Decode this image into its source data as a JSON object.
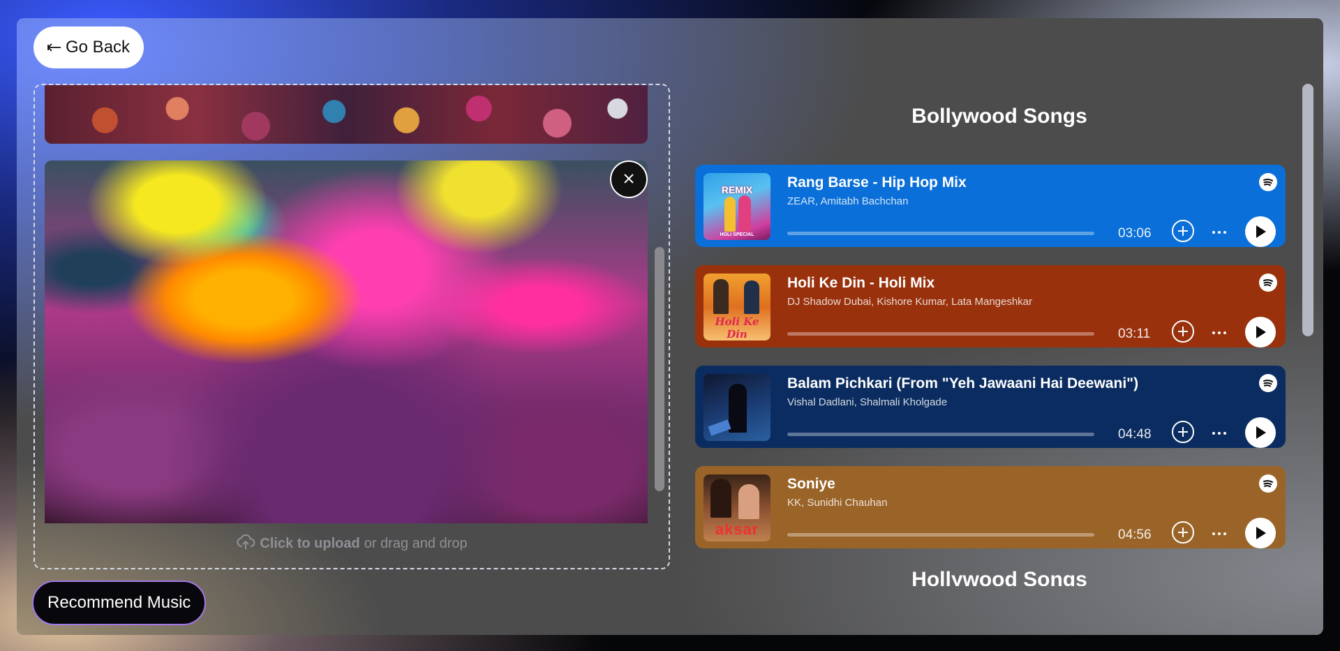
{
  "nav": {
    "back_label": "Go Back"
  },
  "upload": {
    "click_text": "Click to upload",
    "drag_text": "or drag and drop"
  },
  "actions": {
    "recommend_label": "Recommend Music"
  },
  "sections": [
    {
      "title": "Bollywood Songs"
    },
    {
      "title": "Hollywood Songs"
    }
  ],
  "songs": [
    {
      "title": "Rang Barse - Hip Hop Mix",
      "artists": "ZEAR, Amitabh Bachchan",
      "duration": "03:06",
      "color": "#0a6fd8",
      "cover_icon": "album-cover-bollywood-remix"
    },
    {
      "title": "Holi Ke Din - Holi Mix",
      "artists": "DJ Shadow Dubai, Kishore Kumar, Lata Mangeshkar",
      "duration": "03:11",
      "color": "#98310c",
      "cover_icon": "album-cover-holi-ke-din"
    },
    {
      "title": "Balam Pichkari (From \"Yeh Jawaani Hai Deewani\")",
      "artists": "Vishal Dadlani, Shalmali Kholgade",
      "duration": "04:48",
      "color": "#0a2c60",
      "cover_icon": "album-cover-yjhd"
    },
    {
      "title": "Soniye",
      "artists": "KK, Sunidhi Chauhan",
      "duration": "04:56",
      "color": "#9a6428",
      "cover_icon": "album-cover-aksar"
    }
  ],
  "cover_text": {
    "remix": "REMIX",
    "holi_special": "HOLI SPECIAL",
    "holi_ke_din": "Holi Ke Din",
    "aksar": "aksar"
  }
}
